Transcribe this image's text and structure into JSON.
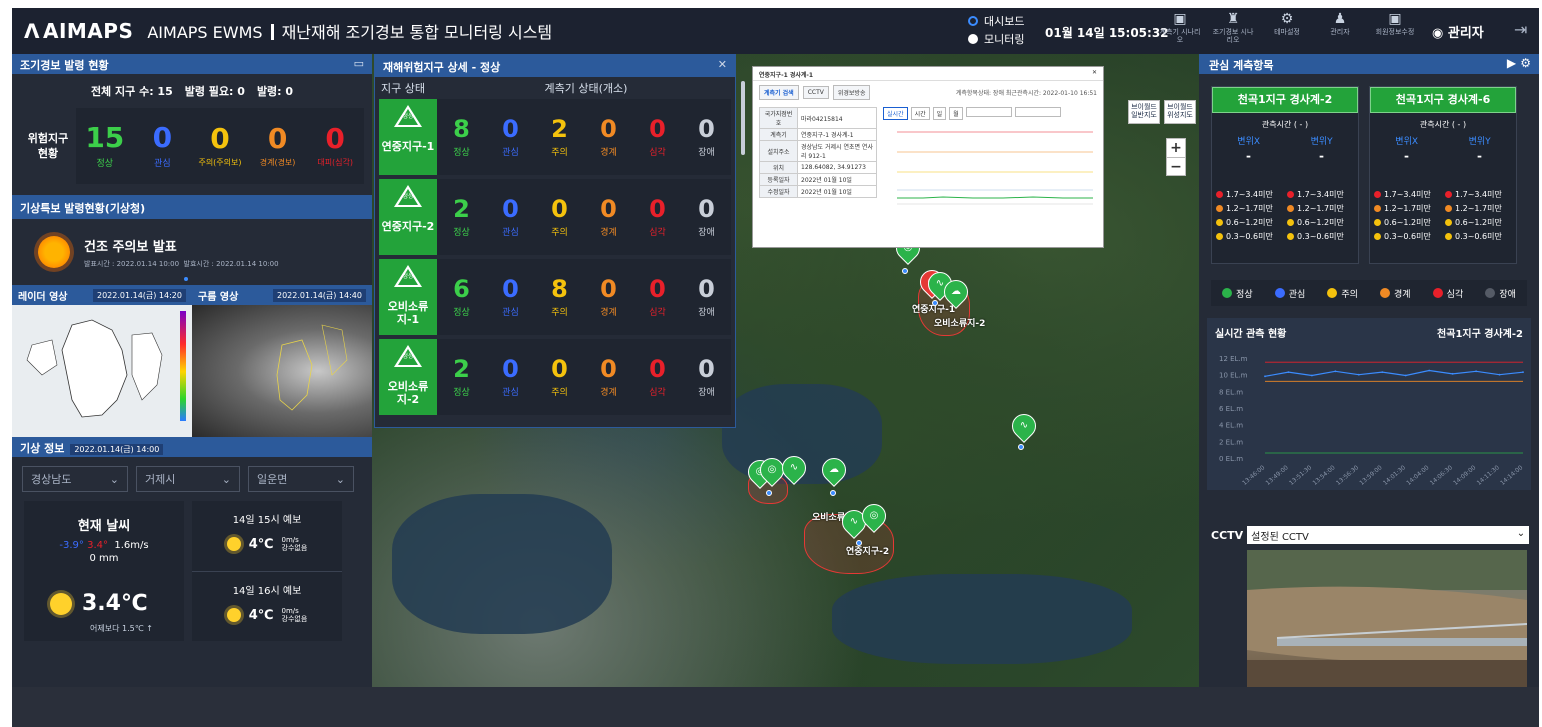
{
  "header": {
    "logo": "AIMAPS",
    "app_name": "AIMAPS EWMS",
    "title": "재난재해 조기경보 통합 모니터링 시스템",
    "modes": [
      "대시보드",
      "모니터링"
    ],
    "datetime": "01월 14일 15:05:32",
    "tools": [
      {
        "label": "계측기 시나리오",
        "icon": "monitor-icon"
      },
      {
        "label": "조기경보 시나리오",
        "icon": "siren-icon"
      },
      {
        "label": "테마설정",
        "icon": "gear-icon"
      },
      {
        "label": "관리자",
        "icon": "person-icon"
      },
      {
        "label": "회원정보수정",
        "icon": "monitor-edit-icon"
      }
    ],
    "user": "관리자"
  },
  "warning_status": {
    "title": "조기경보 발령 현황",
    "total_label": "전체 지구 수: 15",
    "need_label": "발령 필요: 0",
    "issued_label": "발령: 0",
    "risk_label": "위험지구 현황",
    "items": [
      {
        "value": "15",
        "label": "정상",
        "color": "#3ccf4a"
      },
      {
        "value": "0",
        "label": "관심",
        "color": "#3b6cff"
      },
      {
        "value": "0",
        "label": "주의(주의보)",
        "color": "#f4c20d"
      },
      {
        "value": "0",
        "label": "경계(경보)",
        "color": "#f08a24"
      },
      {
        "value": "0",
        "label": "대피(심각)",
        "color": "#e8202a"
      }
    ]
  },
  "weather_alert": {
    "title": "기상특보 발령현황(기상청)",
    "alert": "건조 주의보 발표",
    "issued": "발표시간 : 2022.01.14 10:00",
    "effective": "발효시간 : 2022.01.14 10:00"
  },
  "images": {
    "radar_label": "레이더 영상",
    "radar_date": "2022.01.14(금) 14:20",
    "cloud_label": "구름 영상",
    "cloud_date": "2022.01.14(금) 14:40"
  },
  "weather_info": {
    "title": "기상 정보",
    "date": "2022.01.14(금) 14:00",
    "province": "경상남도",
    "city": "거제시",
    "town": "일운면",
    "now_title": "현재 날씨",
    "min_temp": "-3.9°",
    "max_temp": "3.4°",
    "wind": "1.6m/s",
    "rain": "0 mm",
    "temp": "3.4℃",
    "compare": "어제보다 1.5℃ ↑",
    "forecasts": [
      {
        "time": "14일 15시 예보",
        "temp": "4℃",
        "wind": "0m/s",
        "rain": "강수없음"
      },
      {
        "time": "14일 16시 예보",
        "temp": "4℃",
        "wind": "0m/s",
        "rain": "강수없음"
      }
    ]
  },
  "district_detail": {
    "title": "재해위험지구 상세 - 정상",
    "col_status": "지구 상태",
    "col_instruments": "계측기 상태(개소)",
    "labels": [
      "정상",
      "관심",
      "주의",
      "경계",
      "심각",
      "장애"
    ],
    "rows": [
      {
        "name": "연중지구-1",
        "status": "정상",
        "values": [
          "8",
          "0",
          "2",
          "0",
          "0",
          "0"
        ]
      },
      {
        "name": "연중지구-2",
        "status": "정상",
        "values": [
          "2",
          "0",
          "0",
          "0",
          "0",
          "0"
        ]
      },
      {
        "name": "오비소류지-1",
        "status": "정상",
        "values": [
          "6",
          "0",
          "8",
          "0",
          "0",
          "0"
        ]
      },
      {
        "name": "오비소류지-2",
        "status": "정상",
        "values": [
          "2",
          "0",
          "0",
          "0",
          "0",
          "0"
        ]
      }
    ]
  },
  "popup": {
    "title": "연중지구-1 경사계-1",
    "tabs": [
      "계측기 검색",
      "CCTV",
      "위경보방송"
    ],
    "status": "계측항목상태: 장애 최근관측시간: 2022-01-10 16:51",
    "info": [
      {
        "k": "국가지점번호",
        "v": "마라04215814"
      },
      {
        "k": "계측기",
        "v": "연중지구-1 경사계-1"
      },
      {
        "k": "설치주소",
        "v": "경상남도 거제시 연초면 연사리 912-1"
      },
      {
        "k": "위치",
        "v": "128.64082, 34.91273"
      },
      {
        "k": "등록일자",
        "v": "2022년 01월 10일"
      },
      {
        "k": "수정일자",
        "v": "2022년 01월 10일"
      }
    ],
    "chips": [
      "실시간",
      "시간",
      "일",
      "월"
    ]
  },
  "map": {
    "buttons": [
      "브이월드 일반지도",
      "브이월드 위성지도"
    ],
    "labels": [
      "연중지구-1",
      "오비소류지-1",
      "오비소류지-2",
      "연중지구-2"
    ]
  },
  "right": {
    "title": "관심 계측항목",
    "gauges": [
      {
        "name": "천곡1지구 경사계-2",
        "time": "관측시간 ( - )",
        "x_label": "변위X",
        "y_label": "변위Y",
        "x_val": "-",
        "y_val": "-"
      },
      {
        "name": "천곡1지구 경사계-6",
        "time": "관측시간 ( - )",
        "x_label": "변위X",
        "y_label": "변위Y",
        "x_val": "-",
        "y_val": "-"
      }
    ],
    "ranges": [
      "1.7~3.4미만",
      "1.2~1.7미만",
      "0.6~1.2미만",
      "0.3~0.6미만"
    ],
    "range_colors": [
      "#e8202a",
      "#f08a24",
      "#f4c20d",
      "#f4c20d"
    ],
    "legend": [
      {
        "label": "정상",
        "color": "#2bb34a"
      },
      {
        "label": "관심",
        "color": "#3b6cff"
      },
      {
        "label": "주의",
        "color": "#f4c20d"
      },
      {
        "label": "경계",
        "color": "#f08a24"
      },
      {
        "label": "심각",
        "color": "#e8202a"
      },
      {
        "label": "장애",
        "color": "#555b66"
      }
    ],
    "realtime_title": "실시간 관측 현황",
    "realtime_target": "천곡1지구 경사계-2",
    "cctv_label": "CCTV",
    "cctv_select": "설정된 CCTV"
  },
  "chart_data": {
    "type": "line",
    "title": "실시간 관측 현황",
    "ylabel": "",
    "ylim": [
      0,
      12
    ],
    "y_ticks": [
      "12 EL.m",
      "10 EL.m",
      "8 EL.m",
      "6 EL.m",
      "4 EL.m",
      "2 EL.m",
      "0 EL.m"
    ],
    "x": [
      "13:46:00",
      "13:49:00",
      "13:51:30",
      "13:54:00",
      "13:56:30",
      "13:59:00",
      "14:01:30",
      "14:04:00",
      "14:06:30",
      "14:09:00",
      "14:11:30",
      "14:14:00"
    ],
    "series": [
      {
        "values": [
          9.8,
          10.3,
          9.9,
          10.4,
          10.0,
          10.3,
          9.9,
          10.5,
          10.1,
          10.4,
          10.0,
          10.3
        ],
        "color": "#3b8cff"
      }
    ],
    "thresholds": [
      {
        "value": 11.5,
        "color": "#e8202a"
      },
      {
        "value": 9.2,
        "color": "#f08a24"
      },
      {
        "value": 0.6,
        "color": "#2bb34a"
      }
    ]
  }
}
